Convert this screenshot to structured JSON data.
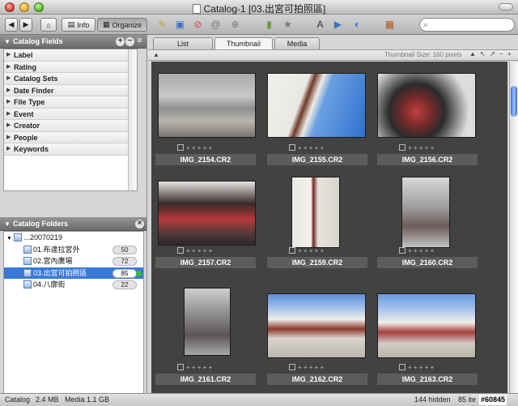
{
  "window": {
    "title": "Catalog-1 [03.出宮可拍照區]"
  },
  "toolbar": {
    "info_label": "Info",
    "organize_label": "Organize",
    "search_placeholder": ""
  },
  "catalog_fields": {
    "header": "Catalog Fields",
    "items": [
      "Label",
      "Rating",
      "Catalog Sets",
      "Date Finder",
      "File Type",
      "Event",
      "Creator",
      "People",
      "Keywords"
    ]
  },
  "catalog_folders": {
    "header": "Catalog Folders",
    "root": "...20070219",
    "items": [
      {
        "label": "01.布達拉宮外",
        "count": "50"
      },
      {
        "label": "02.宮內廣場",
        "count": "72"
      },
      {
        "label": "03.出宮可拍照區",
        "count": "85"
      },
      {
        "label": "04.八廓街",
        "count": "22"
      }
    ]
  },
  "tabs": [
    "List",
    "Thumbnail",
    "Media"
  ],
  "thumb_size_label": "Thumbnail Size: 160 pixels",
  "thumbnails": [
    {
      "name": "IMG_2154.CR2"
    },
    {
      "name": "IMG_2155.CR2"
    },
    {
      "name": "IMG_2156.CR2"
    },
    {
      "name": "IMG_2157.CR2"
    },
    {
      "name": "IMG_2159.CR2"
    },
    {
      "name": "IMG_2160.CR2"
    },
    {
      "name": "IMG_2161.CR2"
    },
    {
      "name": "IMG_2162.CR2"
    },
    {
      "name": "IMG_2163.CR2"
    }
  ],
  "status": {
    "catalog": "Catalog",
    "catalog_size": "2.4 MB",
    "media": "Media 1.1 GB",
    "hidden": "144 hidden",
    "items": "85 ite"
  },
  "watermark": "#60845",
  "colors": {
    "selection": "#3a78d6",
    "grid_bg": "#424242",
    "count_dot": "#2ec02e"
  }
}
